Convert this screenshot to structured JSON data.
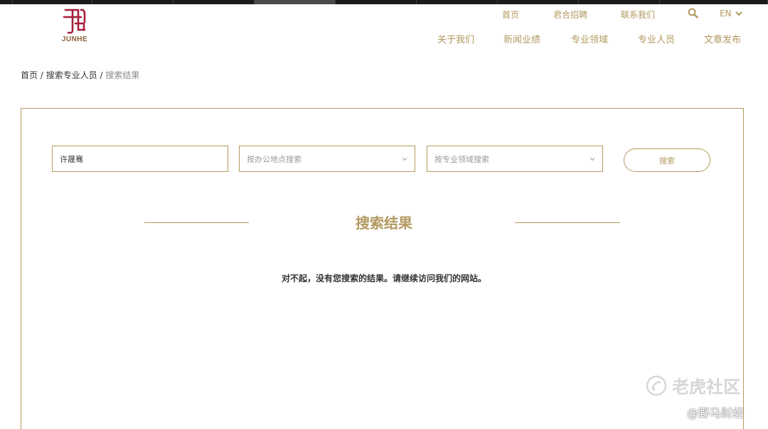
{
  "site": {
    "logo_text": "JUNHE",
    "colors": {
      "accent": "#b39960",
      "logo": "#a51e3a",
      "text": "#333333"
    }
  },
  "utility_nav": {
    "home": "首页",
    "careers": "君合招聘",
    "contact": "联系我们",
    "search_icon": "search-icon",
    "language": "EN"
  },
  "main_nav": [
    "关于我们",
    "新闻业绩",
    "专业领域",
    "专业人员",
    "文章发布"
  ],
  "breadcrumb": {
    "home": "首页",
    "sep": " / ",
    "search_people": "搜索专业人员",
    "current": "搜索结果"
  },
  "search_form": {
    "name_value": "许晟骞",
    "office_placeholder": "按办公地点搜索",
    "practice_placeholder": "按专业领域搜索",
    "submit_label": "搜索"
  },
  "results": {
    "title": "搜索结果",
    "message": "对不起，没有您搜索的结果。请继续访问我们的网站。"
  },
  "watermark": {
    "brand": "老虎社区",
    "handle": "@野马财经"
  }
}
